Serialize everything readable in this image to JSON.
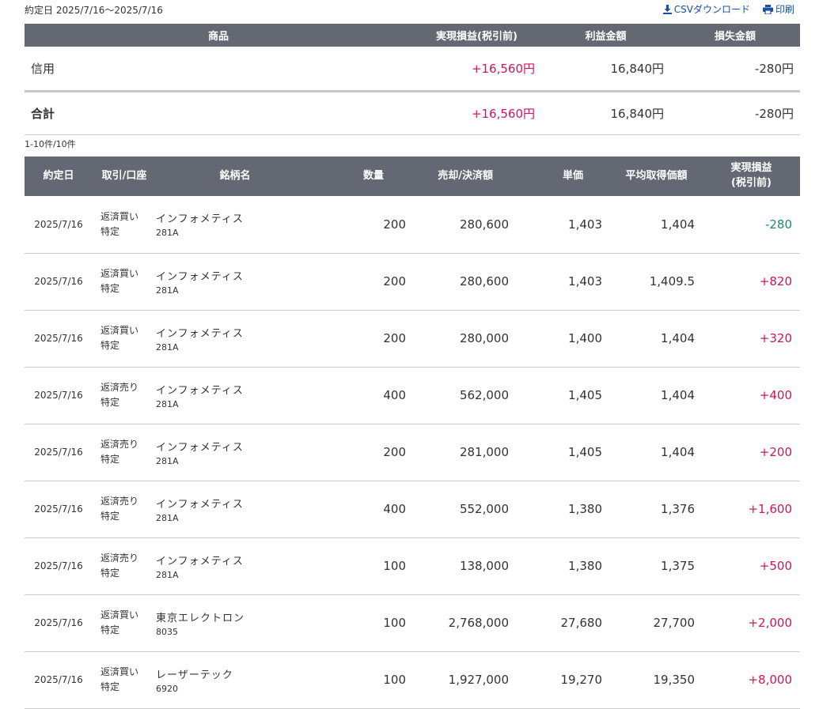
{
  "header": {
    "period_label": "約定日 2025/7/16〜2025/7/16",
    "csv_label": "CSVダウンロード",
    "print_label": "印刷"
  },
  "summary": {
    "headers": [
      "商品",
      "実現損益(税引前)",
      "利益金額",
      "損失金額"
    ],
    "rows": [
      {
        "product": "信用",
        "pl": "+16,560円",
        "profit": "16,840円",
        "loss": "-280円"
      }
    ],
    "total": {
      "label": "合計",
      "pl": "+16,560円",
      "profit": "16,840円",
      "loss": "-280円"
    }
  },
  "count_label": "1-10件/10件",
  "detail": {
    "headers": {
      "date": "約定日",
      "type": "取引/口座",
      "name": "銘柄名",
      "qty": "数量",
      "amount": "売却/決済額",
      "price": "単価",
      "avg": "平均取得価額",
      "pl_line1": "実現損益",
      "pl_line2": "(税引前)"
    },
    "rows": [
      {
        "date": "2025/7/16",
        "type": "返済買い",
        "account": "特定",
        "name": "インフォメティス",
        "code": "281A",
        "qty": "200",
        "amount": "280,600",
        "price": "1,403",
        "avg": "1,404",
        "pl": "-280"
      },
      {
        "date": "2025/7/16",
        "type": "返済買い",
        "account": "特定",
        "name": "インフォメティス",
        "code": "281A",
        "qty": "200",
        "amount": "280,600",
        "price": "1,403",
        "avg": "1,409.5",
        "pl": "+820"
      },
      {
        "date": "2025/7/16",
        "type": "返済買い",
        "account": "特定",
        "name": "インフォメティス",
        "code": "281A",
        "qty": "200",
        "amount": "280,000",
        "price": "1,400",
        "avg": "1,404",
        "pl": "+320"
      },
      {
        "date": "2025/7/16",
        "type": "返済売り",
        "account": "特定",
        "name": "インフォメティス",
        "code": "281A",
        "qty": "400",
        "amount": "562,000",
        "price": "1,405",
        "avg": "1,404",
        "pl": "+400"
      },
      {
        "date": "2025/7/16",
        "type": "返済売り",
        "account": "特定",
        "name": "インフォメティス",
        "code": "281A",
        "qty": "200",
        "amount": "281,000",
        "price": "1,405",
        "avg": "1,404",
        "pl": "+200"
      },
      {
        "date": "2025/7/16",
        "type": "返済売り",
        "account": "特定",
        "name": "インフォメティス",
        "code": "281A",
        "qty": "400",
        "amount": "552,000",
        "price": "1,380",
        "avg": "1,376",
        "pl": "+1,600"
      },
      {
        "date": "2025/7/16",
        "type": "返済売り",
        "account": "特定",
        "name": "インフォメティス",
        "code": "281A",
        "qty": "100",
        "amount": "138,000",
        "price": "1,380",
        "avg": "1,375",
        "pl": "+500"
      },
      {
        "date": "2025/7/16",
        "type": "返済買い",
        "account": "特定",
        "name": "東京エレクトロン",
        "code": "8035",
        "qty": "100",
        "amount": "2,768,000",
        "price": "27,680",
        "avg": "27,700",
        "pl": "+2,000"
      },
      {
        "date": "2025/7/16",
        "type": "返済買い",
        "account": "特定",
        "name": "レーザーテック",
        "code": "6920",
        "qty": "100",
        "amount": "1,927,000",
        "price": "19,270",
        "avg": "19,350",
        "pl": "+8,000"
      }
    ]
  },
  "colors": {
    "header_bg": "#646873",
    "positive": "#d2145a",
    "negative": "#1a8a7a",
    "link": "#1a4fa0"
  },
  "icons": {
    "csv": "download-icon",
    "print": "printer-icon"
  }
}
